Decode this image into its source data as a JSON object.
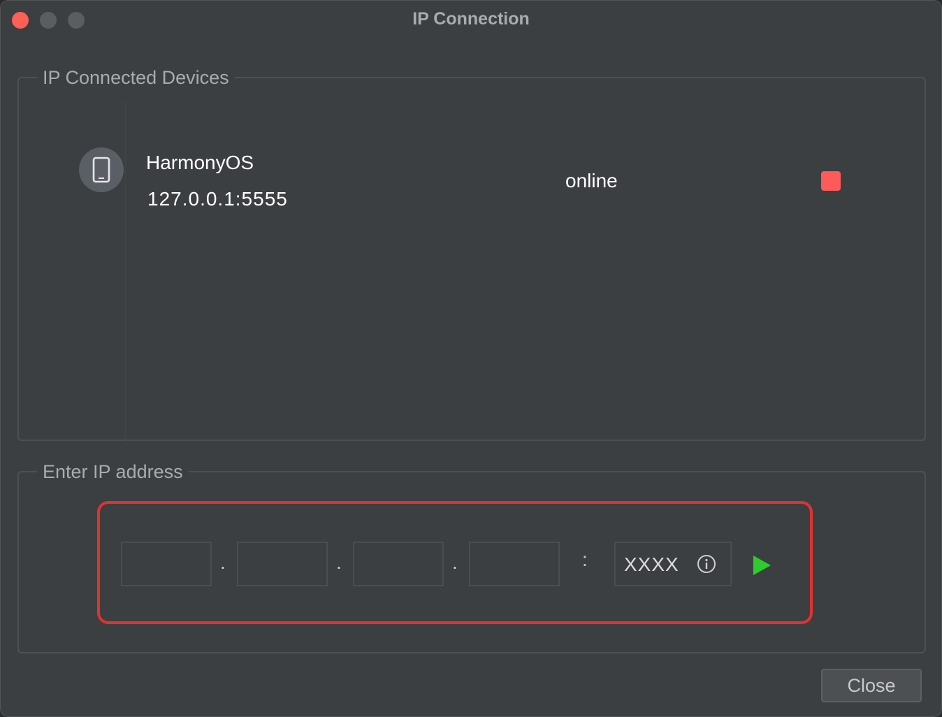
{
  "window": {
    "title": "IP Connection"
  },
  "devices_group": {
    "legend": "IP Connected Devices",
    "devices": [
      {
        "name": "HarmonyOS",
        "address": "127.0.0.1:5555",
        "status": "online",
        "icon": "phone-icon",
        "action_icon": "stop-icon"
      }
    ]
  },
  "ip_group": {
    "legend": "Enter IP address",
    "octets": [
      "",
      "",
      "",
      ""
    ],
    "octet_separator": ".",
    "port_separator": ":",
    "port_placeholder": "XXXX",
    "connect_icon": "play-icon"
  },
  "footer": {
    "close_label": "Close"
  },
  "colors": {
    "window_bg": "#3c3f41",
    "stop": "#fe5a5a",
    "play": "#2ecc2e",
    "highlight": "#e1322f",
    "close_traffic": "#fe5f57"
  }
}
